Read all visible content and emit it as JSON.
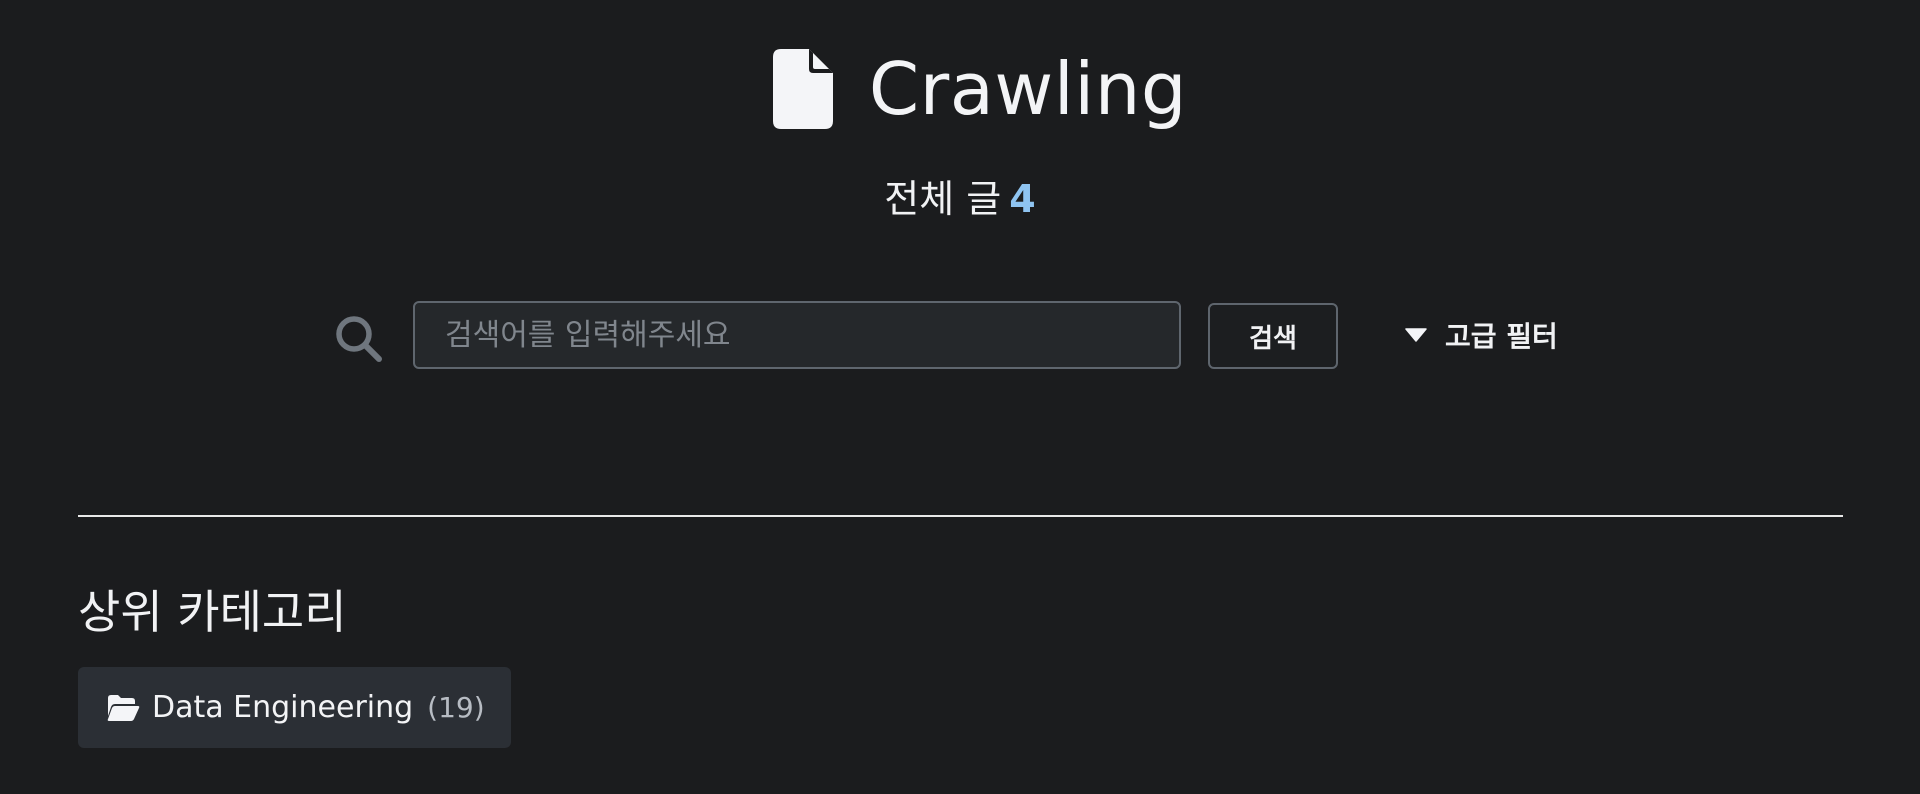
{
  "header": {
    "title": "Crawling",
    "icon": "file-icon"
  },
  "summary": {
    "label": "전체 글",
    "count": "4",
    "count_color": "#8fc4f1"
  },
  "search": {
    "placeholder": "검색어를 입력해주세요",
    "value": "",
    "button_label": "검색",
    "icon": "search-icon"
  },
  "advanced_filter": {
    "label": "고급 필터",
    "icon": "caret-down-icon"
  },
  "categories": {
    "title": "상위 카테고리",
    "items": [
      {
        "name": "Data Engineering",
        "count": "(19)",
        "icon": "folder-open-icon"
      }
    ]
  },
  "colors": {
    "background": "#1b1c1e",
    "chip_background": "#2b2f35",
    "accent": "#8fc4f1"
  }
}
